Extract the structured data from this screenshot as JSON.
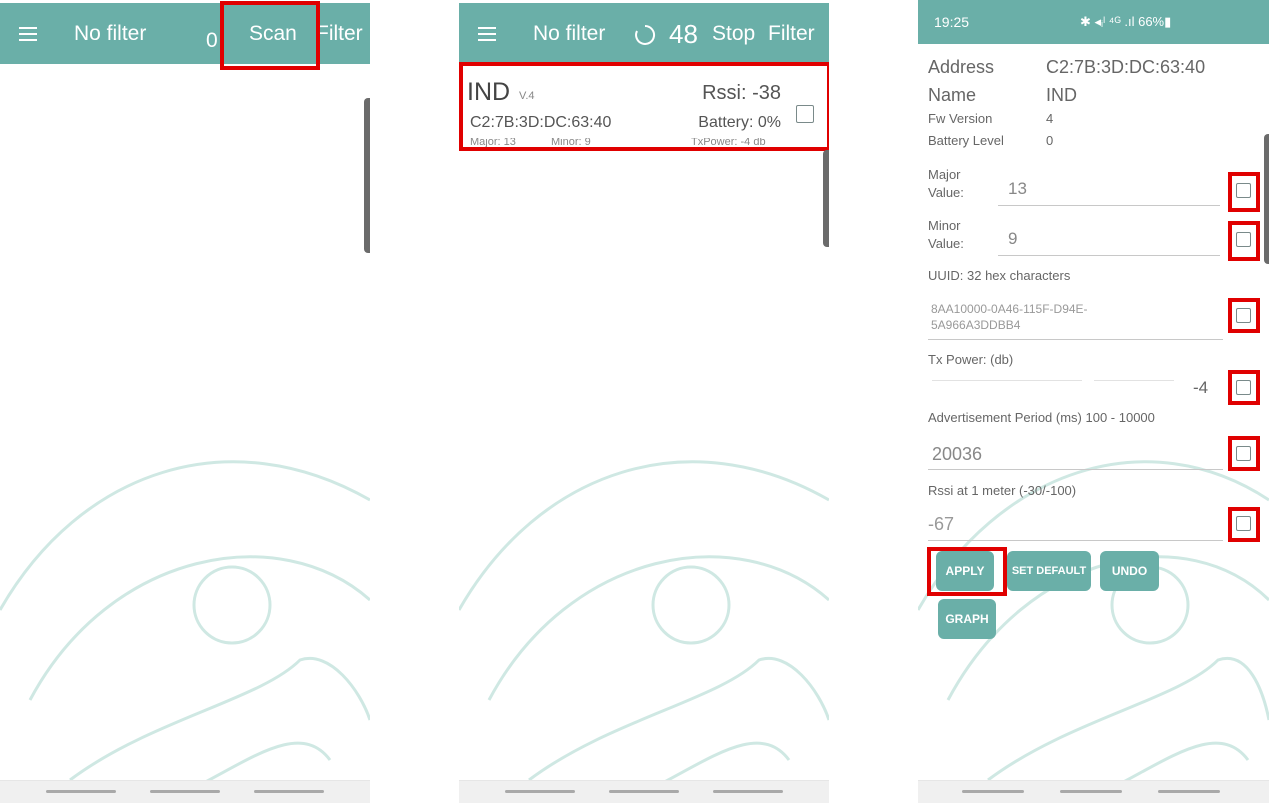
{
  "panel1": {
    "toolbar": {
      "filter_label": "No filter",
      "count": "0",
      "scan_label": "Scan",
      "filter_button": "Filter"
    }
  },
  "panel2": {
    "toolbar": {
      "filter_label": "No filter",
      "count": "48",
      "stop_label": "Stop",
      "filter_button": "Filter"
    },
    "device": {
      "name": "IND",
      "version": "V.4",
      "rssi": "Rssi: -38",
      "mac": "C2:7B:3D:DC:63:40",
      "battery": "Battery: 0%",
      "major": "Major: 13",
      "minor": "Minor: 9",
      "txpower": "TxPower: -4 db"
    }
  },
  "panel3": {
    "status": {
      "time": "19:25",
      "icons": "✱ ◂ᵢˡ ⁴ᴳ .ıl 66%▮"
    },
    "info": [
      {
        "label": "Address",
        "value": "C2:7B:3D:DC:63:40"
      },
      {
        "label": "Name",
        "value": "IND"
      },
      {
        "label": "Fw Version",
        "value": "4"
      },
      {
        "label": "Battery Level",
        "value": "0"
      }
    ],
    "major": {
      "label1": "Major",
      "label2": "Value:",
      "value": "13"
    },
    "minor": {
      "label1": "Minor",
      "label2": "Value:",
      "value": "9"
    },
    "uuid": {
      "label": "UUID: 32 hex characters",
      "line1": "8AA10000-0A46-115F-D94E-",
      "line2": "5A966A3DDBB4"
    },
    "tx": {
      "label": "Tx Power: (db)",
      "value": "-4"
    },
    "adv": {
      "label": "Advertisement Period (ms) 100 - 10000",
      "value": "20036"
    },
    "rssi1m": {
      "label": "Rssi at 1 meter (-30/-100)",
      "value": "-67"
    },
    "buttons": {
      "apply": "APPLY",
      "set_default": "SET DEFAULT",
      "undo": "UNDO",
      "graph": "GRAPH"
    }
  },
  "colors": {
    "accent": "#6aafa8",
    "highlight": "#e00000"
  }
}
